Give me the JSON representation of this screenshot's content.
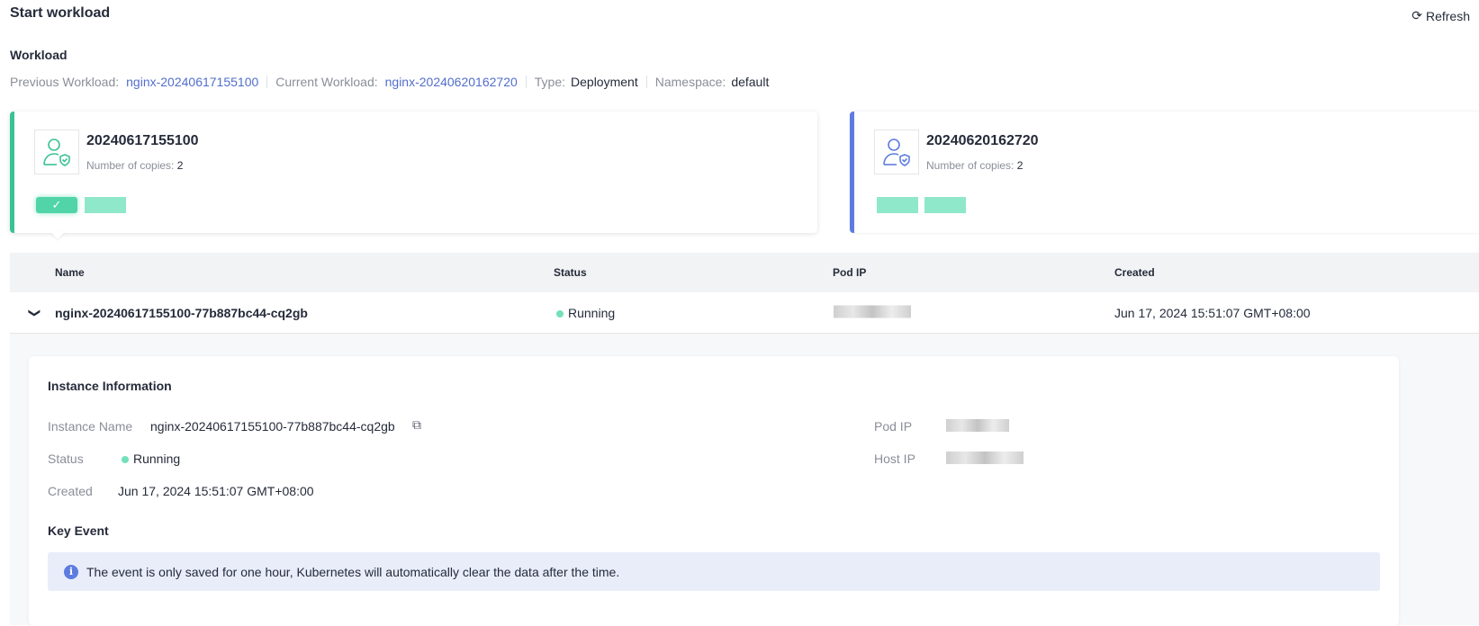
{
  "header": {
    "title": "Start workload",
    "refresh": "Refresh"
  },
  "workload": {
    "heading": "Workload",
    "prev_label": "Previous Workload:",
    "prev_value": "nginx-20240617155100",
    "cur_label": "Current Workload:",
    "cur_value": "nginx-20240620162720",
    "type_label": "Type:",
    "type_value": "Deployment",
    "ns_label": "Namespace:",
    "ns_value": "default"
  },
  "cards": [
    {
      "name": "20240617155100",
      "copies_label": "Number of copies:",
      "copies": "2"
    },
    {
      "name": "20240620162720",
      "copies_label": "Number of copies:",
      "copies": "2"
    }
  ],
  "colors": {
    "previous": "#3ac295",
    "current": "#5e7ce0",
    "pod": "#8ee8c9"
  },
  "table": {
    "headers": [
      "Name",
      "Status",
      "Pod IP",
      "Created"
    ],
    "row": {
      "name": "nginx-20240617155100-77b887bc44-cq2gb",
      "status": "Running",
      "created": "Jun 17, 2024 15:51:07 GMT+08:00"
    }
  },
  "instance": {
    "heading": "Instance Information",
    "name_label": "Instance Name",
    "name": "nginx-20240617155100-77b887bc44-cq2gb",
    "status_label": "Status",
    "status": "Running",
    "created_label": "Created",
    "created": "Jun 17, 2024 15:51:07 GMT+08:00",
    "podip_label": "Pod IP",
    "hostip_label": "Host IP"
  },
  "events": {
    "heading": "Key Event",
    "notice": "The event is only saved for one hour, Kubernetes will automatically clear the data after the time."
  }
}
